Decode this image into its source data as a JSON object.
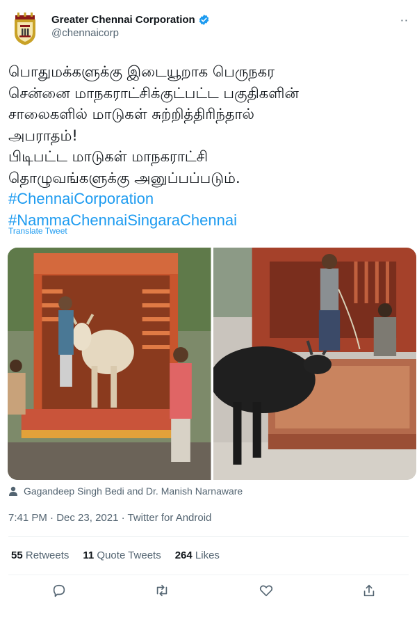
{
  "account": {
    "display_name": "Greater Chennai Corporation",
    "handle": "@chennaicorp",
    "verified": true,
    "more_label": "··"
  },
  "tweet": {
    "lines": [
      "பொதுமக்களுக்கு இடையூறாக பெருநகர",
      "சென்னை மாநகராட்சிக்குட்பட்ட பகுதிகளின்",
      "சாலைகளில் மாடுகள் சுற்றித்திரிந்தால்",
      "அபராதம்!",
      "பிடிபட்ட மாடுகள் மாநகராட்சி",
      "தொழுவங்களுக்கு அனுப்பப்படும்."
    ],
    "hashtags": [
      "#ChennaiCorporation",
      "#NammaChennaiSingaraChennai"
    ],
    "translate_label": "Translate Tweet"
  },
  "media": {
    "photos": [
      "cow-loading-truck-photo",
      "bull-beside-cage-photo"
    ]
  },
  "tagged_people": "Gagandeep Singh Bedi and Dr. Manish Narnaware",
  "meta": {
    "time": "7:41 PM",
    "date": "Dec 23, 2021",
    "source": "Twitter for Android",
    "separator": " · "
  },
  "stats": {
    "retweets_count": "55",
    "retweets_label": "Retweets",
    "quotes_count": "11",
    "quotes_label": "Quote Tweets",
    "likes_count": "264",
    "likes_label": "Likes"
  },
  "actions": [
    "reply-icon",
    "retweet-icon",
    "like-icon",
    "share-icon"
  ],
  "colors": {
    "accent": "#1d9bf0",
    "text": "#0f1419",
    "muted": "#536471",
    "divider": "#eff3f4"
  }
}
